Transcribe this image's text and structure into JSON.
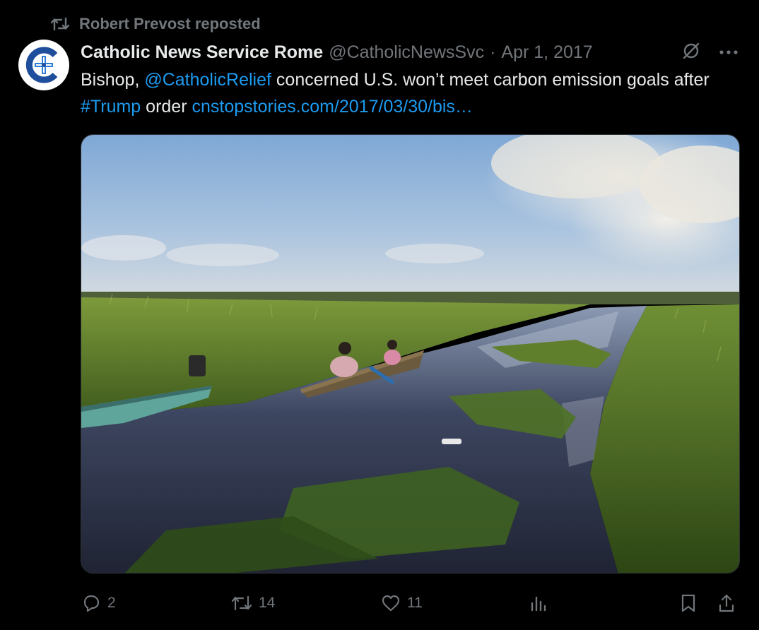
{
  "repost": {
    "icon": "repost-icon",
    "text": "Robert Prevost reposted"
  },
  "tweet": {
    "avatar_icon": "catholic-news-service-logo",
    "author_name": "Catholic News Service Rome",
    "handle": "@CatholicNewsSvc",
    "separator": "·",
    "date": "Apr 1, 2017",
    "grok_icon": "grok-icon",
    "more_icon": "more-icon",
    "text_parts": {
      "p1": "Bishop, ",
      "mention": "@CatholicRelief",
      "p2": " concerned U.S. won’t meet carbon emission goals after ",
      "hashtag": "#Trump",
      "p3": " order ",
      "url": "cnstopstories.com/2017/03/30/bis…"
    },
    "media_description_icon": "wetland-photo"
  },
  "actions": {
    "reply": {
      "icon": "reply-icon",
      "count": "2"
    },
    "retweet": {
      "icon": "retweet-icon",
      "count": "14"
    },
    "like": {
      "icon": "heart-icon",
      "count": "11"
    },
    "views": {
      "icon": "views-icon"
    },
    "bookmark": {
      "icon": "bookmark-icon"
    },
    "share": {
      "icon": "share-icon"
    }
  },
  "colors": {
    "background": "#000000",
    "text": "#e7e9ea",
    "muted": "#71767b",
    "link": "#1d9bf0"
  }
}
